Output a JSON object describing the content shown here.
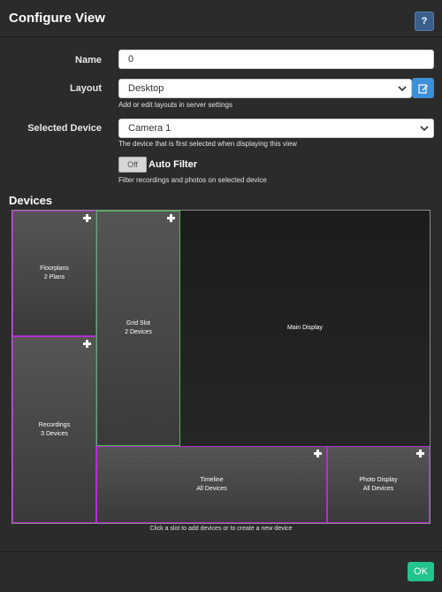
{
  "dialog": {
    "title": "Configure View",
    "help_label": "?"
  },
  "form": {
    "name": {
      "label": "Name",
      "value": "0"
    },
    "layout": {
      "label": "Layout",
      "value": "Desktop",
      "help": "Add or edit layouts in server settings",
      "edit_icon": "pencil-square-icon"
    },
    "selected_device": {
      "label": "Selected Device",
      "value": "Camera 1",
      "help": "The device that is first selected when displaying this view"
    },
    "auto_filter": {
      "toggle": "Off",
      "label": "Auto Filter",
      "help": "Filter recordings and photos on selected device"
    }
  },
  "devices": {
    "title": "Devices",
    "slots": {
      "floorplans": {
        "name": "Floorplans",
        "detail": "2 Plans"
      },
      "grid": {
        "name": "Grid Slot",
        "detail": "2 Devices"
      },
      "main": {
        "name": "Main Display"
      },
      "recordings": {
        "name": "Recordings",
        "detail": "3 Devices"
      },
      "timeline": {
        "name": "Timeline",
        "detail": "All Devices"
      },
      "photo": {
        "name": "Photo Display",
        "detail": "All Devices"
      }
    },
    "hint": "Click a slot to add devices or to create a new device"
  },
  "footer": {
    "ok_label": "OK"
  },
  "colors": {
    "background": "#2b2b2b",
    "slot_border_purple": "#b42fcf",
    "slot_border_green": "#3bc24a",
    "ok_button": "#23c48e",
    "edit_button": "#3d8fd6",
    "help_button": "#3a5f8c"
  }
}
